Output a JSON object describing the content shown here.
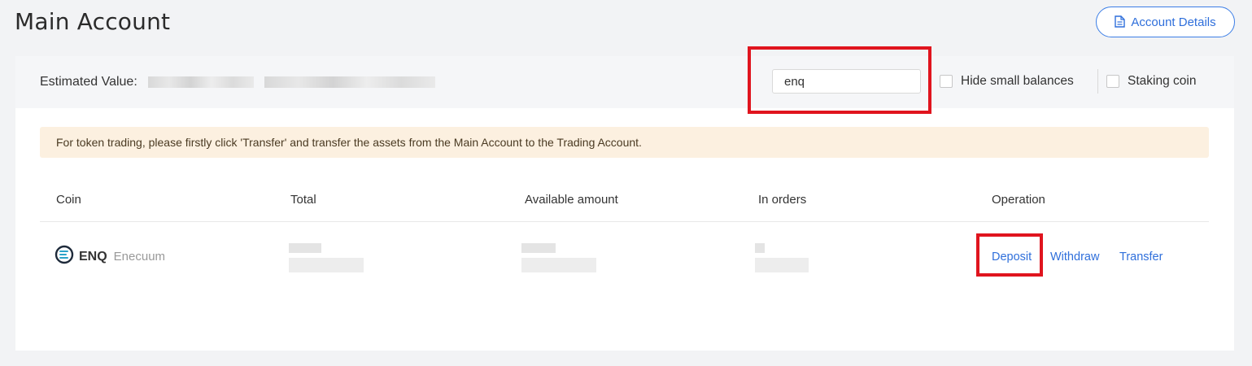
{
  "page": {
    "title": "Main Account",
    "account_details_label": "Account Details"
  },
  "header": {
    "estimated_value_label": "Estimated Value:",
    "search": {
      "value": "enq",
      "placeholder": ""
    },
    "hide_small_balances_label": "Hide small balances",
    "staking_coin_label": "Staking coin"
  },
  "notice": {
    "text": "For token trading, please firstly click 'Transfer' and transfer the assets from the Main Account to the Trading Account."
  },
  "table": {
    "columns": [
      "Coin",
      "Total",
      "Available amount",
      "In orders",
      "Operation"
    ],
    "rows": [
      {
        "symbol": "ENQ",
        "name": "Enecuum",
        "operations": [
          "Deposit",
          "Withdraw",
          "Transfer"
        ]
      }
    ]
  },
  "colors": {
    "accent": "#2f6fdb",
    "highlight": "#e0141e",
    "notice_bg": "#fcf0e0"
  }
}
